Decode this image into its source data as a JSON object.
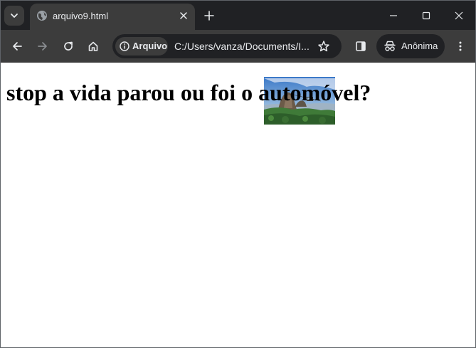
{
  "browser": {
    "tab": {
      "title": "arquivo9.html"
    },
    "address_bar": {
      "chip_label": "Arquivo",
      "url": "C:/Users/vanza/Documents/I..."
    },
    "profile": {
      "label": "Anônima"
    }
  },
  "page": {
    "heading": "stop a vida parou ou foi o automóvel?",
    "image": {
      "description_icon": "photo-landscape"
    }
  },
  "colors": {
    "titlebar": "#202124",
    "toolbar": "#3c3c3c",
    "omnibox": "#202124",
    "text_light": "#e8eaed",
    "page_bg": "#ffffff"
  }
}
